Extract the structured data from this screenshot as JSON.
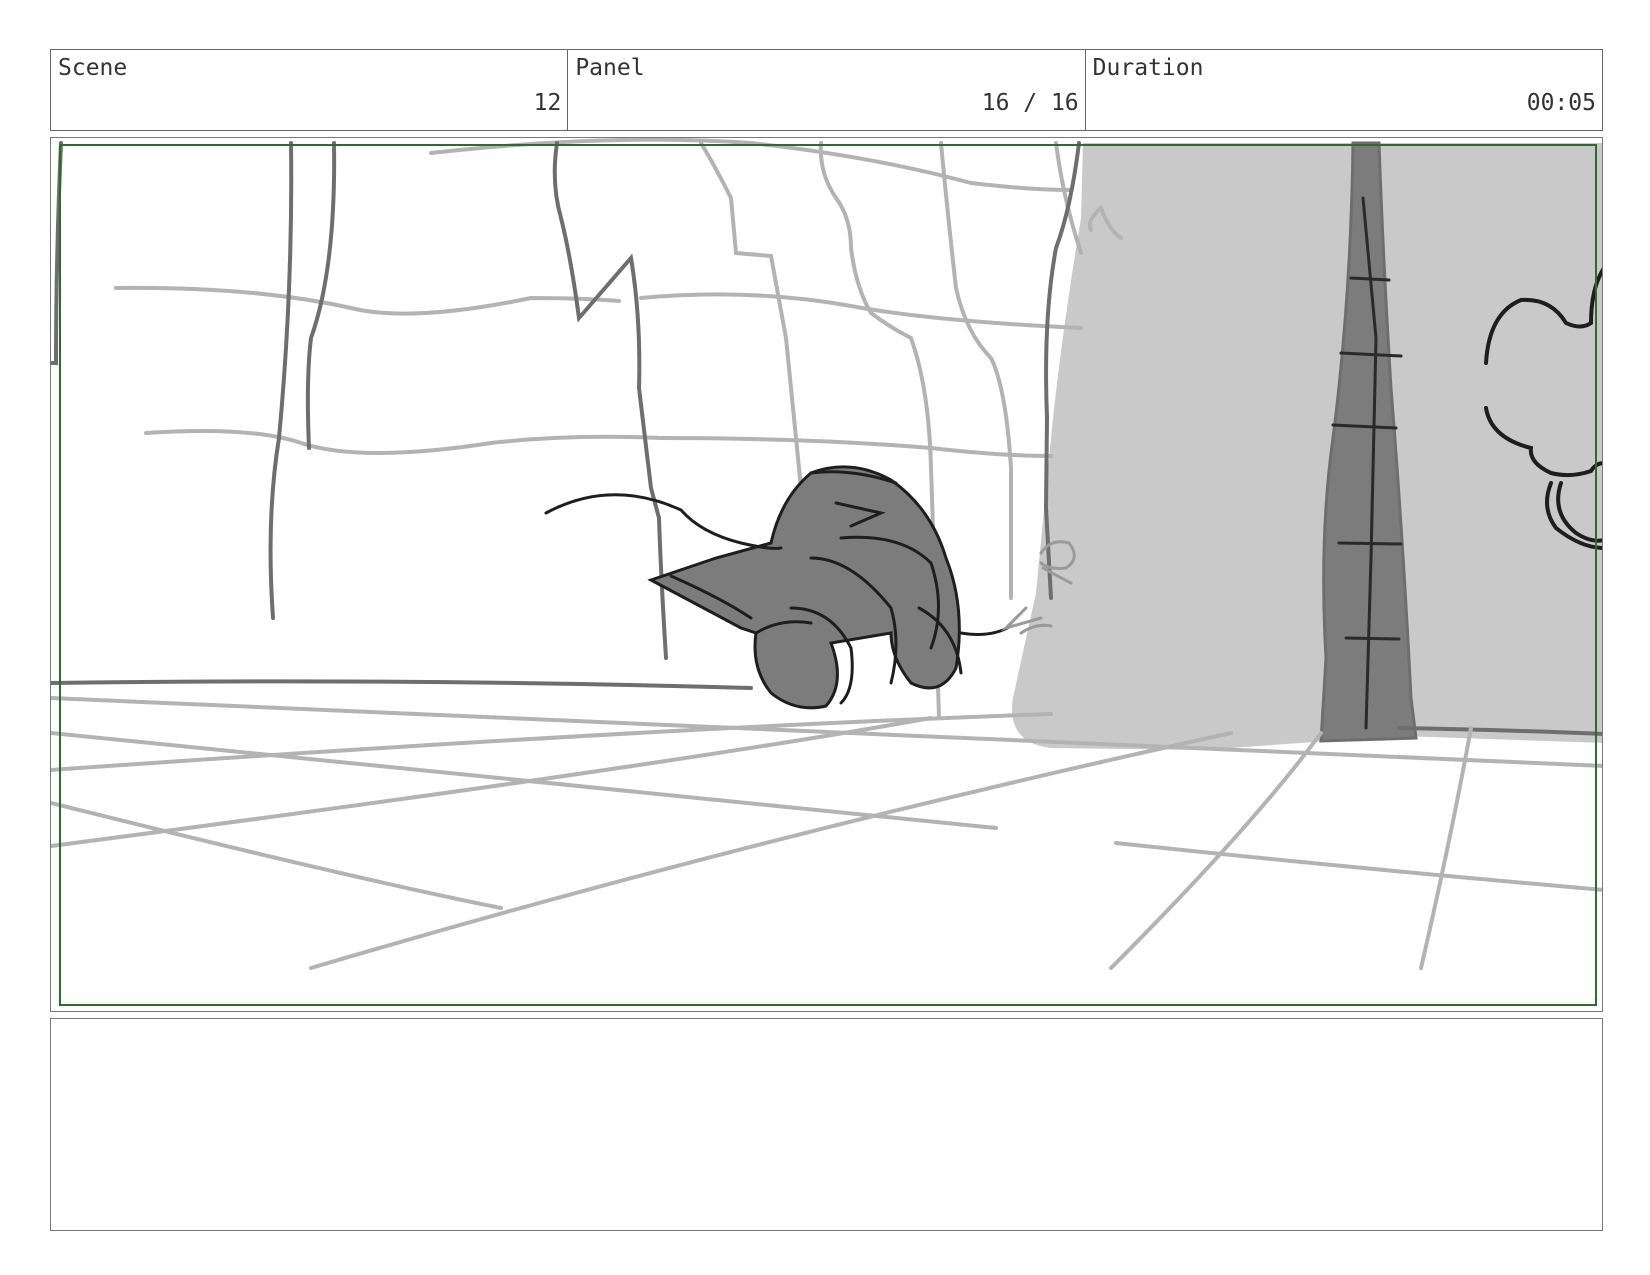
{
  "header": {
    "scene": {
      "label": "Scene",
      "value": "12"
    },
    "panel": {
      "label": "Panel",
      "value": "16 / 16"
    },
    "duration": {
      "label": "Duration",
      "value": "00:05"
    }
  },
  "colors": {
    "safe_frame": "#2e6b2e",
    "sketch_light": "#b3b3b3",
    "sketch_mid": "#6e6e6e",
    "sketch_dark": "#1e1e1e",
    "fill_light": "#c9c9c9",
    "fill_dark": "#7c7c7c"
  },
  "notes": {
    "text": ""
  }
}
